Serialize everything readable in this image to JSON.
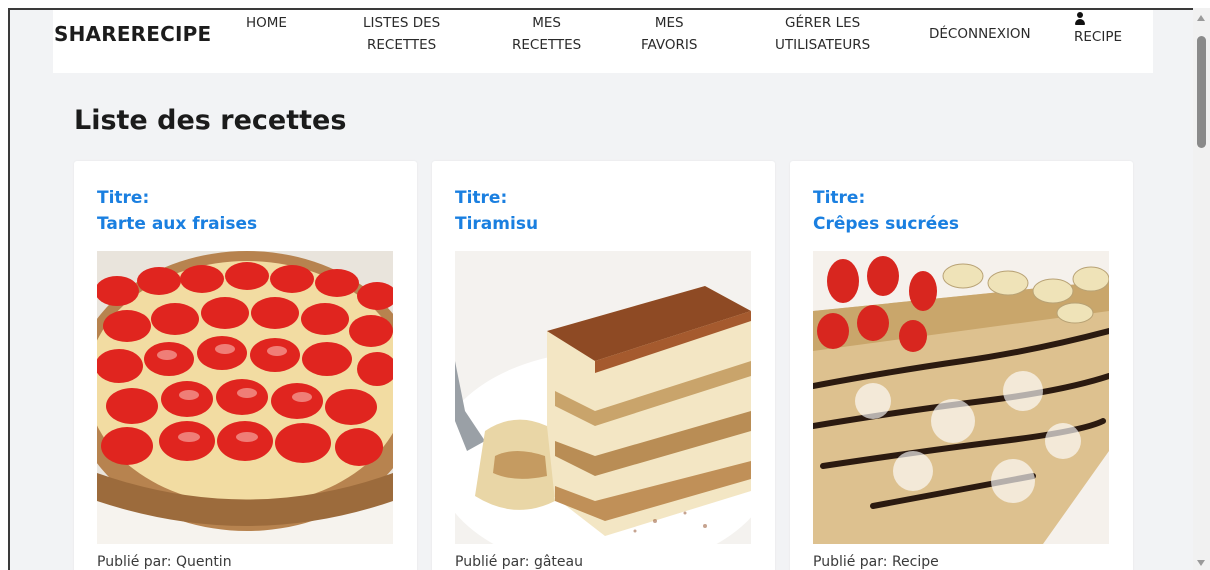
{
  "navbar": {
    "brand": "SHARERECIPE",
    "items": [
      {
        "lines": [
          "HOME"
        ]
      },
      {
        "lines": [
          "LISTES DES",
          "RECETTES"
        ]
      },
      {
        "lines": [
          "MES",
          "RECETTES"
        ]
      },
      {
        "lines": [
          "MES",
          "FAVORIS"
        ]
      },
      {
        "lines": [
          "GÉRER LES",
          "UTILISATEURS"
        ]
      },
      {
        "lines": [
          "DÉCONNEXION"
        ]
      },
      {
        "lines": [
          "RECIPE"
        ],
        "icon": "user-icon"
      }
    ]
  },
  "page": {
    "title": "Liste des recettes"
  },
  "recipes": [
    {
      "title_label": "Titre:",
      "title": "Tarte aux fraises",
      "author": "Publié par: Quentin",
      "image": "strawberry-tart"
    },
    {
      "title_label": "Titre:",
      "title": "Tiramisu",
      "author": "Publié par: gâteau",
      "image": "tiramisu"
    },
    {
      "title_label": "Titre:",
      "title": "Crêpes sucrées",
      "author": "Publié par: Recipe",
      "image": "crepes"
    }
  ],
  "colors": {
    "accent": "#1a7fe0",
    "background": "#f2f3f5",
    "card": "#ffffff",
    "text": "#1b1b1b"
  }
}
